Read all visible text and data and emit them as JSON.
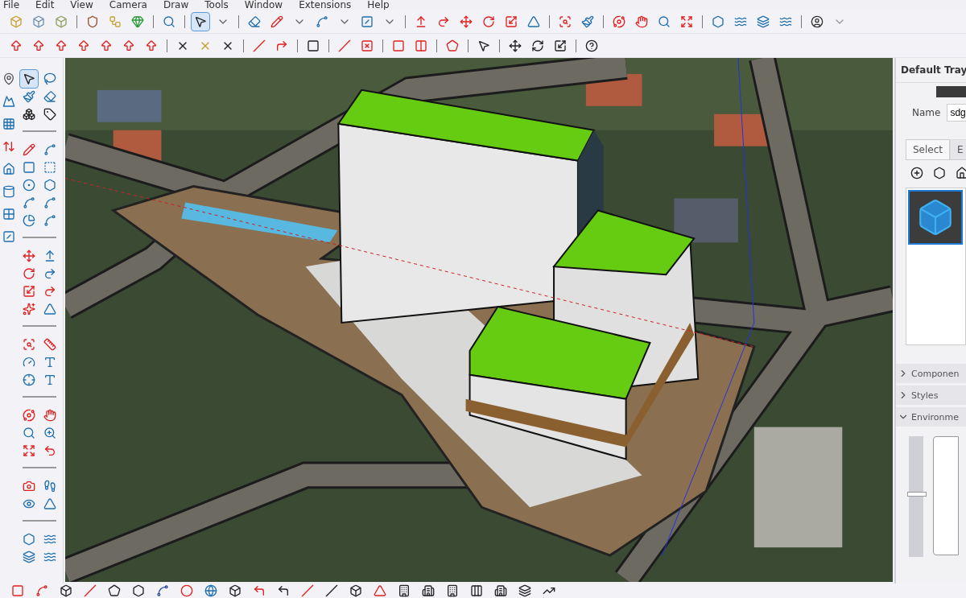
{
  "menu": [
    "File",
    "Edit",
    "View",
    "Camera",
    "Draw",
    "Tools",
    "Window",
    "Extensions",
    "Help"
  ],
  "tray": {
    "title": "Default Tray",
    "name_label": "Name",
    "name_value": "sdg",
    "tabs": [
      {
        "label": "Select",
        "selected": true
      },
      {
        "label": "E",
        "selected": false
      }
    ],
    "panels": [
      {
        "label": "Componen",
        "expanded": false
      },
      {
        "label": "Styles",
        "expanded": false
      },
      {
        "label": "Environme",
        "expanded": true
      }
    ],
    "environment_slider": {
      "level": 0.5
    }
  }
}
